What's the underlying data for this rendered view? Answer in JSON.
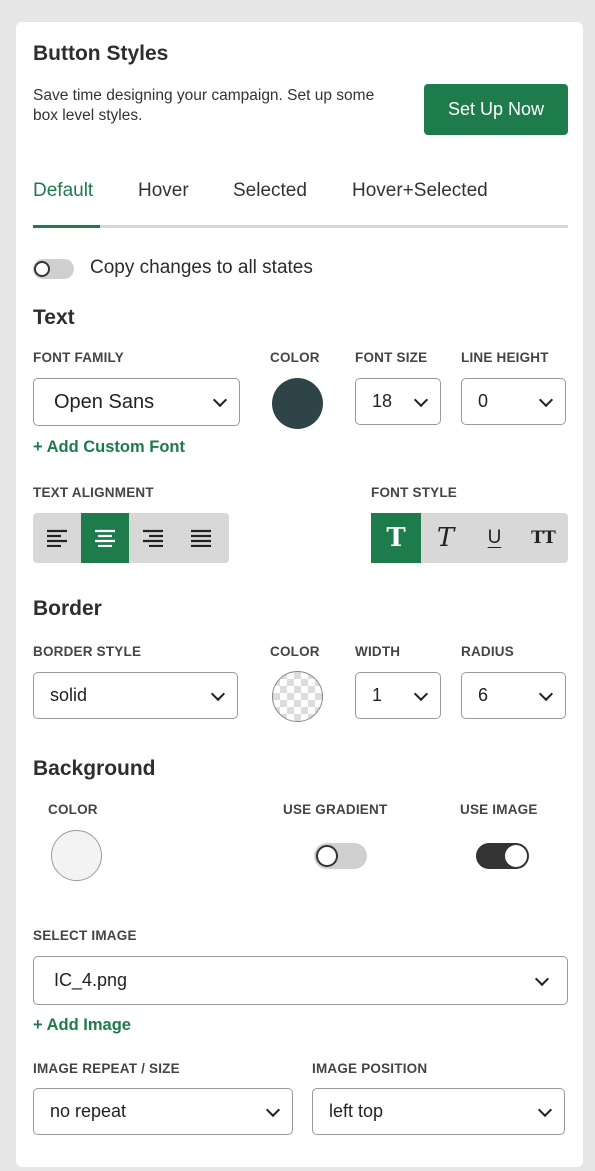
{
  "header": {
    "title": "Button Styles",
    "description": "Save time designing your campaign. Set up some box level styles.",
    "setup_button": "Set Up Now"
  },
  "tabs": [
    {
      "label": "Default",
      "active": true
    },
    {
      "label": "Hover",
      "active": false
    },
    {
      "label": "Selected",
      "active": false
    },
    {
      "label": "Hover+Selected",
      "active": false
    }
  ],
  "copy_toggle": {
    "label": "Copy changes to all states",
    "on": false
  },
  "text_section": {
    "title": "Text",
    "font_family_label": "FONT FAMILY",
    "font_family_value": "Open Sans",
    "color_label": "COLOR",
    "color_value": "#2f4448",
    "font_size_label": "FONT SIZE",
    "font_size_value": "18",
    "line_height_label": "LINE HEIGHT",
    "line_height_value": "0",
    "add_font_link": "+ Add Custom Font",
    "alignment_label": "TEXT ALIGNMENT",
    "alignment_selected": "center",
    "font_style_label": "FONT STYLE",
    "font_style_selected": "bold",
    "font_style_glyphs": {
      "bold": "T",
      "italic": "T",
      "underline": "U",
      "caps": "TT"
    }
  },
  "border_section": {
    "title": "Border",
    "style_label": "BORDER STYLE",
    "style_value": "solid",
    "color_label": "COLOR",
    "width_label": "WIDTH",
    "width_value": "1",
    "radius_label": "RADIUS",
    "radius_value": "6"
  },
  "background_section": {
    "title": "Background",
    "color_label": "COLOR",
    "color_value": "#f3f3f3",
    "gradient_label": "USE GRADIENT",
    "gradient_on": false,
    "image_label": "USE IMAGE",
    "image_on": true,
    "select_image_label": "SELECT IMAGE",
    "select_image_value": "IC_4.png",
    "add_image_link": "+ Add Image",
    "repeat_label": "IMAGE REPEAT / SIZE",
    "repeat_value": "no repeat",
    "position_label": "IMAGE POSITION",
    "position_value": "left top"
  },
  "colors": {
    "accent": "#1e7b4c",
    "panel_bg": "#ffffff",
    "page_bg": "#e6e6e6"
  }
}
